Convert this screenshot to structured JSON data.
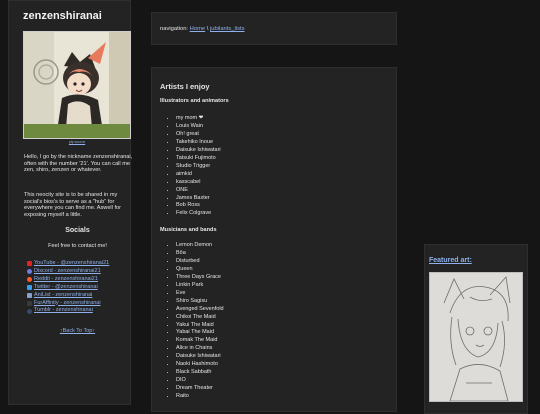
{
  "sidebar": {
    "site_title": "zenzenshiranai",
    "avatar_caption": "pfp source",
    "bio": [
      "Hello, I go by the nickname zenzenshiranai, often with the number '21'. You can call me zen, shiro, zenzen or whatever.",
      "This neocity site is to be shared in my social's bios's to serve as a \"hub\" for everywhere you can find me. Aswell for exposing myself a little."
    ],
    "socials_title": "Socials",
    "contact_line": "Feel free to contact me!",
    "links": [
      {
        "icon": "youtube-icon",
        "color": "#e02424",
        "label": "YouTube - @zenzenshiranai21"
      },
      {
        "icon": "discord-icon",
        "color": "#6d7de0",
        "label": "Discord - zenzenshiranai21"
      },
      {
        "icon": "reddit-icon",
        "color": "#ff5a1f",
        "label": "Reddit - zenzenshiranai21"
      },
      {
        "icon": "twitter-icon",
        "color": "#3aa0ee",
        "label": "Twitter - @zenzenshiranai"
      },
      {
        "icon": "anilist-icon",
        "color": "#8aa0c8",
        "label": "AniList - zenzenshiranai"
      },
      {
        "icon": "furaffinity-icon",
        "color": "#3a3a3a",
        "label": "FurAffinity - zenzenshiranai"
      },
      {
        "icon": "tumblr-icon",
        "color": "#3a4a66",
        "label": "Tumblr - zenzenshiranai"
      }
    ],
    "back_to_top": "↑Back To Top↑"
  },
  "nav": {
    "prefix": "navigation:",
    "home": "Home",
    "separator": "\\",
    "current": "jubilants_lists"
  },
  "main": {
    "title": "Artists I enjoy",
    "illustrators_title": "Illustrators and animators",
    "illustrators": [
      "my mom ❤",
      "Louis Wain",
      "Oh! great",
      "Takehiko Inoue",
      "Daisuke Ishiwatari",
      "Tatsuki Fujimoto",
      "Studio Trigger",
      "aimkid",
      "kasscabel",
      "ONE",
      "James Baxter",
      "Bob Ross",
      "Felix Colgrave"
    ],
    "musicians_title": "Musicians and bands",
    "musicians": [
      "Lemon Demon",
      "Bôa",
      "Disturbed",
      "Queen",
      "Three Days Grace",
      "Linkin Park",
      "Eve",
      "Shiro Sagisu",
      "Avenged Sevenfold",
      "Chikoi The Maid",
      "Yakui The Maid",
      "Yabai The Maid",
      "Komak The Maid",
      "Alice in Chains",
      "Daisuke Ishiwatari",
      "Naoki Hashimoto",
      "Black Sabbath",
      "DIO",
      "Dream Theater",
      "Raito"
    ]
  },
  "featured": {
    "title": "Featured art:"
  },
  "colors": {
    "background": "#151515",
    "panel": "#232323",
    "text": "#e6e6e6",
    "link": "#8fb0ea"
  }
}
